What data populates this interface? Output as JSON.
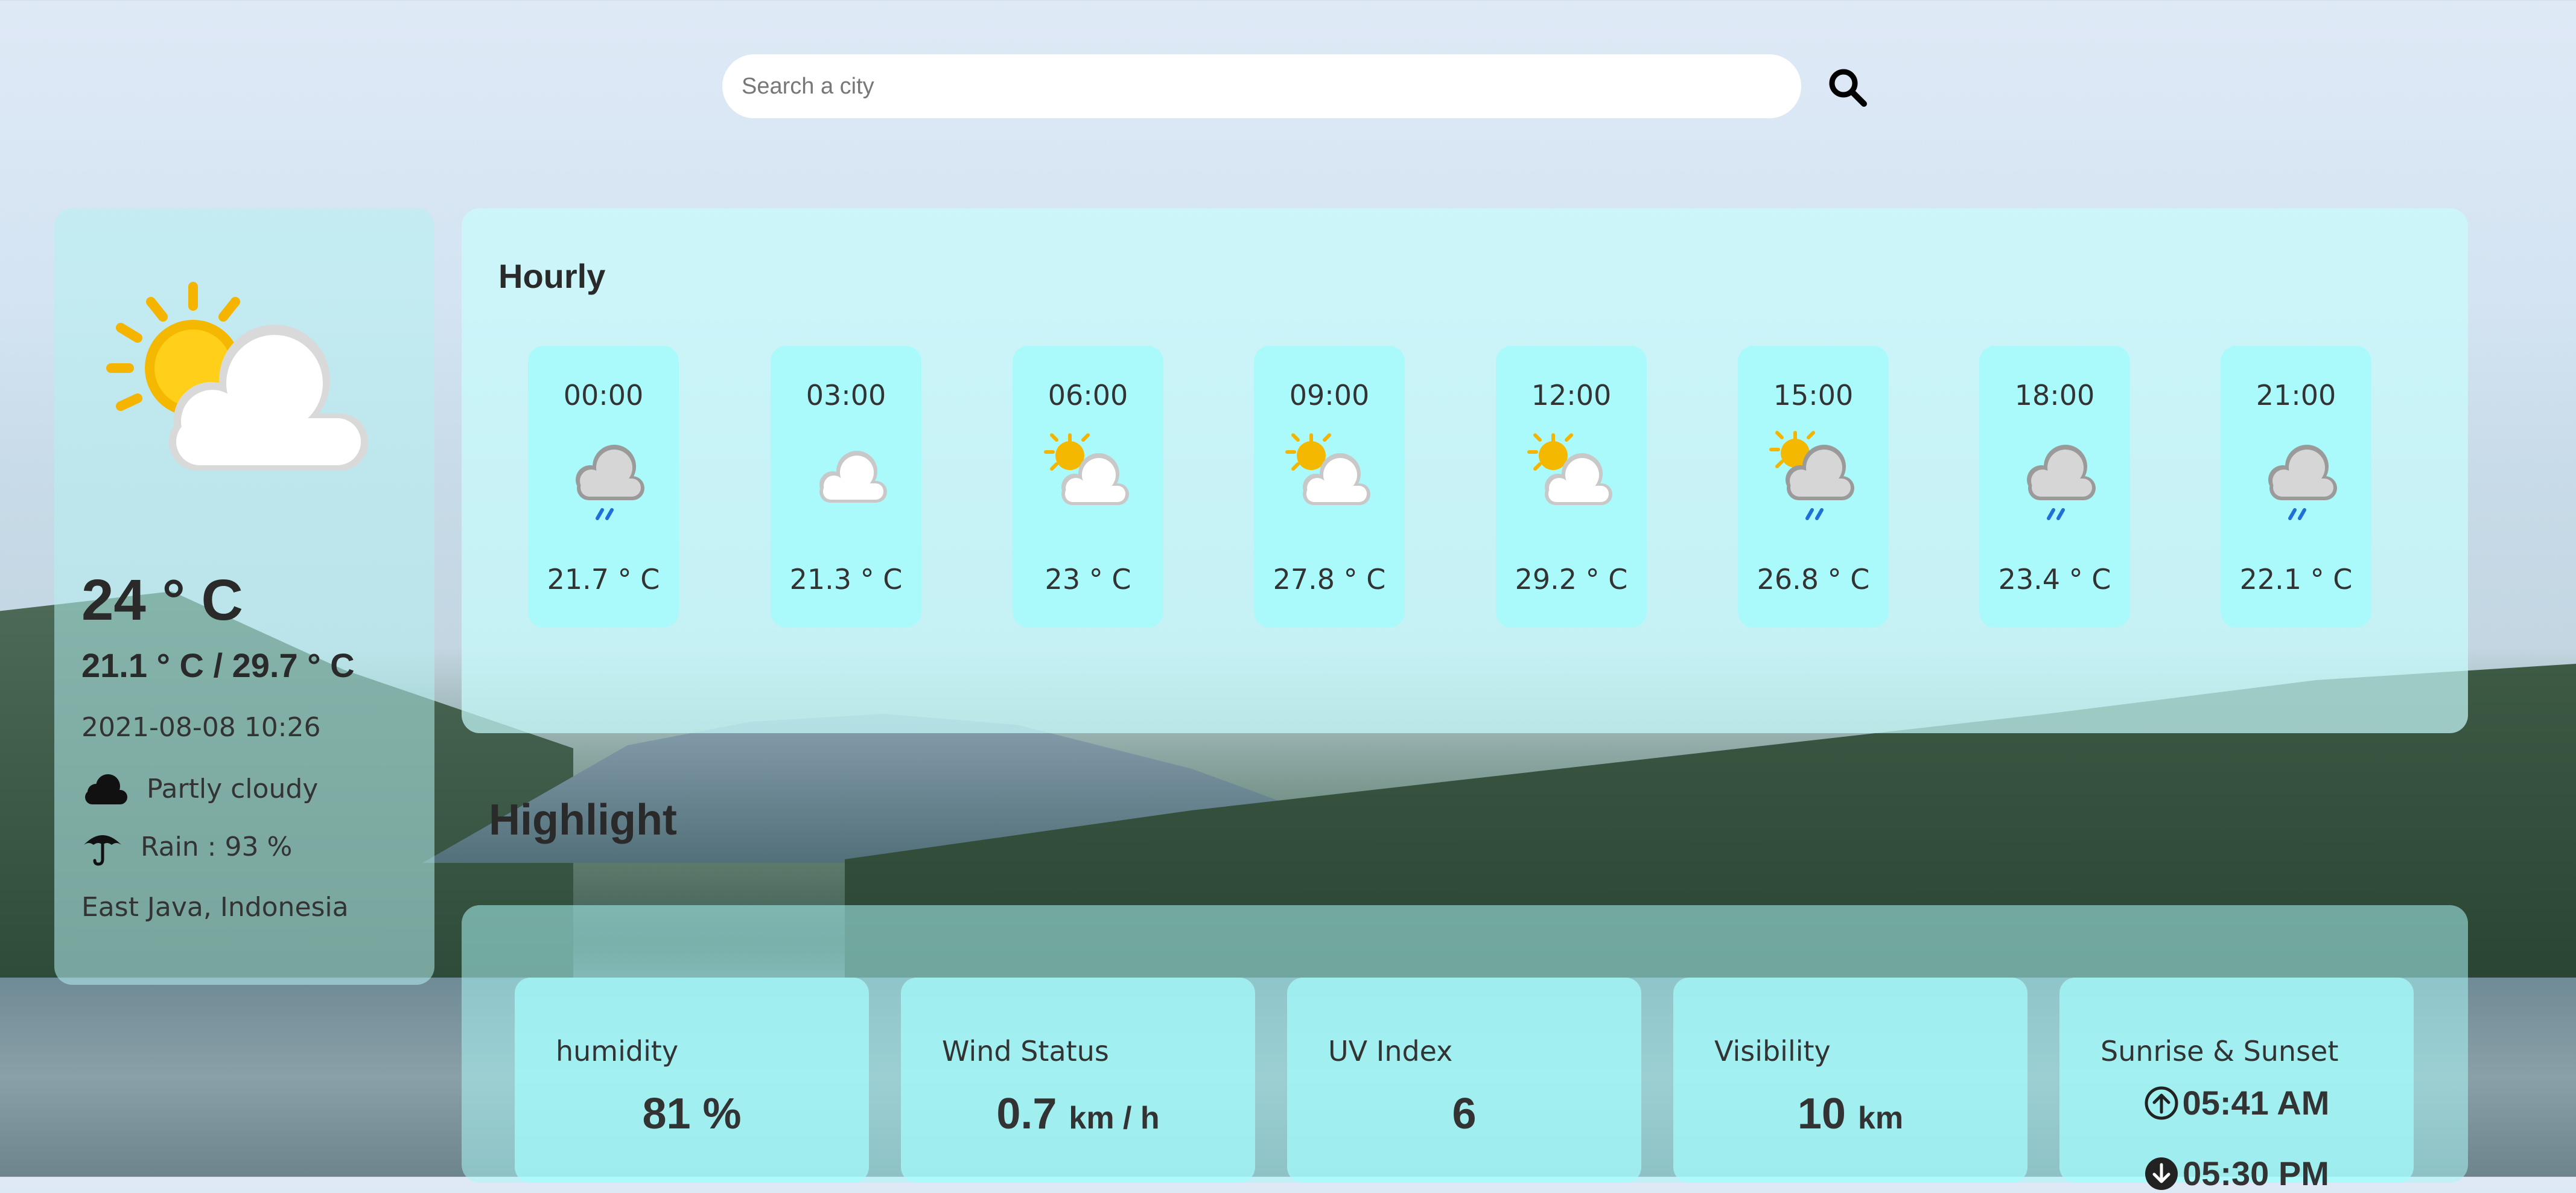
{
  "search": {
    "placeholder": "Search a city"
  },
  "current": {
    "temperature": "24 ° C",
    "range": "21.1 ° C / 29.7 ° C",
    "datetime": "2021-08-08 10:26",
    "condition": "Partly cloudy",
    "rain": "Rain : 93 %",
    "location": "East Java, Indonesia",
    "icon": "sun-behind-cloud-icon"
  },
  "hourly": {
    "title": "Hourly",
    "items": [
      {
        "time": "00:00",
        "temp": "21.7 ° C",
        "icon": "moon-cloud-rain-icon"
      },
      {
        "time": "03:00",
        "temp": "21.3 ° C",
        "icon": "moon-cloud-icon"
      },
      {
        "time": "06:00",
        "temp": "23 ° C",
        "icon": "sun-cloud-icon"
      },
      {
        "time": "09:00",
        "temp": "27.8 ° C",
        "icon": "sun-cloud-icon"
      },
      {
        "time": "12:00",
        "temp": "29.2 ° C",
        "icon": "sun-cloud-icon"
      },
      {
        "time": "15:00",
        "temp": "26.8 ° C",
        "icon": "sun-cloud-rain-icon"
      },
      {
        "time": "18:00",
        "temp": "23.4 ° C",
        "icon": "moon-cloud-rain-icon"
      },
      {
        "time": "21:00",
        "temp": "22.1 ° C",
        "icon": "moon-cloud-rain-icon"
      }
    ]
  },
  "highlight": {
    "title": "Highlight",
    "humidity": {
      "label": "humidity",
      "value": "81 %"
    },
    "wind": {
      "label": "Wind Status",
      "value": "0.7",
      "unit": "km / h"
    },
    "uv": {
      "label": "UV Index",
      "value": "6"
    },
    "visibility": {
      "label": "Visibility",
      "value": "10",
      "unit": "km"
    },
    "sun": {
      "label": "Sunrise & Sunset",
      "sunrise": "05:41 AM",
      "sunset": "05:30 PM"
    }
  },
  "colors": {
    "panel": "#bffafa",
    "card": "#a6fcfc",
    "accent_blue": "#1e6fd9",
    "sun": "#f5b800"
  }
}
